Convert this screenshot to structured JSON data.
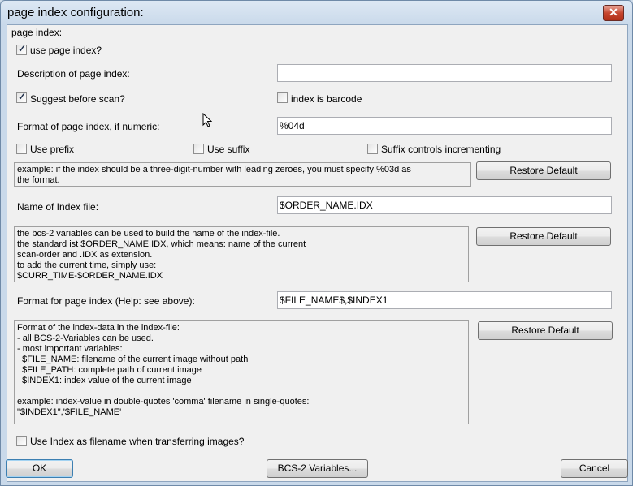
{
  "window": {
    "title": "page index configuration:",
    "close_glyph": "✕"
  },
  "group": {
    "label": "page index:"
  },
  "use_page_index": {
    "label": "use page index?",
    "checked": true
  },
  "description": {
    "label": "Description of page index:",
    "value": ""
  },
  "suggest_before_scan": {
    "label": "Suggest before scan?",
    "checked": true
  },
  "index_is_barcode": {
    "label": "index is barcode",
    "checked": false
  },
  "format_numeric": {
    "label": "Format of page index, if numeric:",
    "value": "%04d"
  },
  "use_prefix": {
    "label": "Use prefix",
    "checked": false
  },
  "use_suffix": {
    "label": "Use suffix",
    "checked": false
  },
  "suffix_controls": {
    "label": "Suffix controls incrementing",
    "checked": false
  },
  "format_help": "example: if the index should be a three-digit-number with leading zeroes, you must specify %03d as\nthe format.",
  "restore_default_label": "Restore Default",
  "index_file": {
    "label": "Name of Index file:",
    "value": "$ORDER_NAME.IDX"
  },
  "index_file_help": "the bcs-2 variables can be used to build the name of the index-file.\nthe standard ist $ORDER_NAME.IDX, which means: name of the current\nscan-order and .IDX as extension.\nto add the current time, simply use:\n$CURR_TIME-$ORDER_NAME.IDX",
  "page_format": {
    "label": "Format for page index (Help: see above):",
    "value": "$FILE_NAME$,$INDEX1"
  },
  "page_format_help": "Format of the index-data in the index-file:\n- all BCS-2-Variables can be used.\n- most important variables:\n  $FILE_NAME: filename of the current image without path\n  $FILE_PATH: complete path of current image\n  $INDEX1: index value of the current image\n\nexample: index-value in double-quotes 'comma' filename in single-quotes:\n\"$INDEX1\",'$FILE_NAME'",
  "use_index_filename": {
    "label": "Use Index as filename when transferring images?",
    "checked": false
  },
  "footer": {
    "ok_label": "OK",
    "variables_label": "BCS-2 Variables...",
    "cancel_label": "Cancel"
  },
  "check_glyph": "✓"
}
